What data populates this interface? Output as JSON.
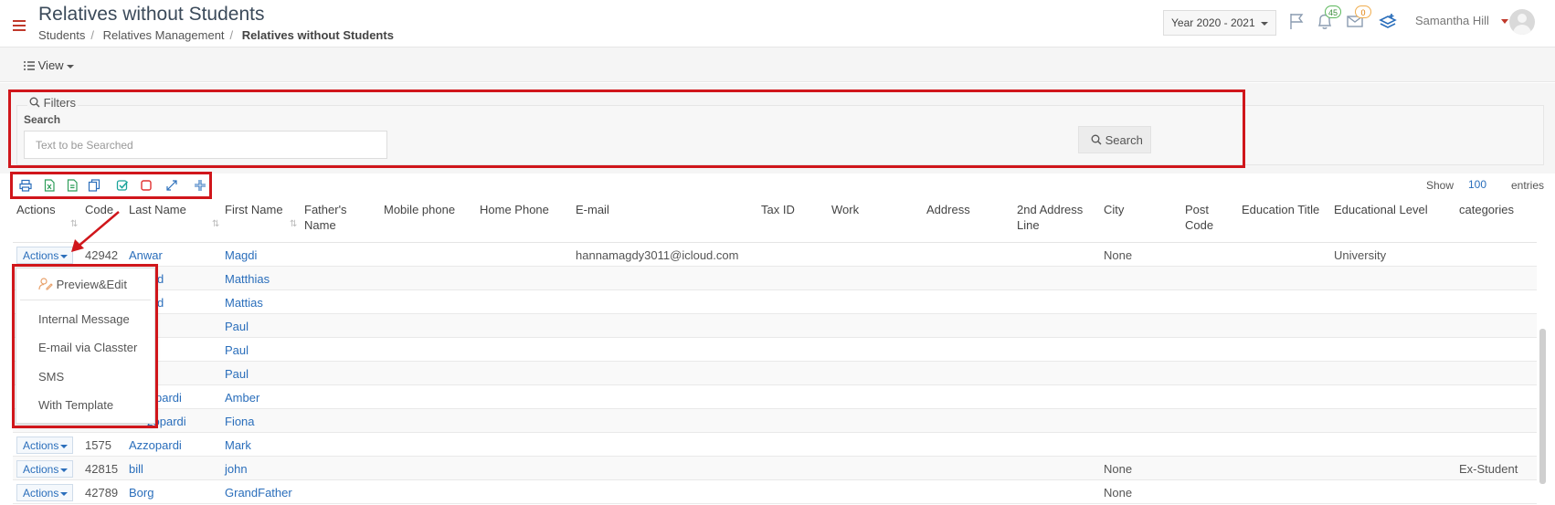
{
  "header": {
    "title": "Relatives without Students",
    "breadcrumbs": [
      "Students",
      "Relatives Management",
      "Relatives without Students"
    ],
    "year_select": "Year 2020 - 2021",
    "notifications_count": "45",
    "messages_count": "0",
    "user_name": "Samantha Hill"
  },
  "toolbar": {
    "view_label": "View"
  },
  "filters": {
    "legend": "Filters",
    "search_label": "Search",
    "search_placeholder": "Text to be Searched",
    "search_button": "Search"
  },
  "table_controls": {
    "show_label": "Show",
    "show_value": "100",
    "entries_label": "entries"
  },
  "table": {
    "columns": [
      "Actions",
      "Code",
      "Last Name",
      "First Name",
      "Father's Name",
      "Mobile phone",
      "Home Phone",
      "E-mail",
      "Tax ID",
      "Work",
      "Address",
      "2nd Address Line",
      "City",
      "Post Code",
      "Education Title",
      "Educational Level",
      "categories"
    ],
    "actions_label": "Actions",
    "rows": [
      {
        "code": "42942",
        "last_name": "Anwar",
        "first_name": "Magdi",
        "email": "hannamagdy3011@icloud.com",
        "city": "None",
        "educational_level": "University",
        "categories": ""
      },
      {
        "code": "",
        "last_name": "d",
        "first_name": "Matthias",
        "email": "",
        "city": "",
        "educational_level": "",
        "categories": ""
      },
      {
        "code": "",
        "last_name": "d",
        "first_name": "Mattias",
        "email": "",
        "city": "",
        "educational_level": "",
        "categories": ""
      },
      {
        "code": "",
        "last_name": "",
        "first_name": "Paul",
        "email": "",
        "city": "",
        "educational_level": "",
        "categories": ""
      },
      {
        "code": "",
        "last_name": "",
        "first_name": "Paul",
        "email": "",
        "city": "",
        "educational_level": "",
        "categories": ""
      },
      {
        "code": "",
        "last_name": "",
        "first_name": "Paul",
        "email": "",
        "city": "",
        "educational_level": "",
        "categories": ""
      },
      {
        "code": "",
        "last_name": "pardi",
        "first_name": "Amber",
        "email": "",
        "city": "",
        "educational_level": "",
        "categories": ""
      },
      {
        "code": "",
        "last_name": "zopardi",
        "first_name": "Fiona",
        "email": "",
        "city": "",
        "educational_level": "",
        "categories": ""
      },
      {
        "code": "1575",
        "last_name": "Azzopardi",
        "first_name": "Mark",
        "email": "",
        "city": "",
        "educational_level": "",
        "categories": ""
      },
      {
        "code": "42815",
        "last_name": "bill",
        "first_name": "john",
        "email": "",
        "city": "None",
        "educational_level": "",
        "categories": "Ex-Student"
      },
      {
        "code": "42789",
        "last_name": "Borg",
        "first_name": "GrandFather",
        "email": "",
        "city": "None",
        "educational_level": "",
        "categories": ""
      }
    ]
  },
  "actions_menu": {
    "items": [
      "Preview&Edit",
      "Internal Message",
      "E-mail via Classter",
      "SMS",
      "With Template"
    ]
  },
  "colors": {
    "accent": "#2a6ebb",
    "annotation": "#d0161b",
    "brand_red": "#c0392b"
  }
}
